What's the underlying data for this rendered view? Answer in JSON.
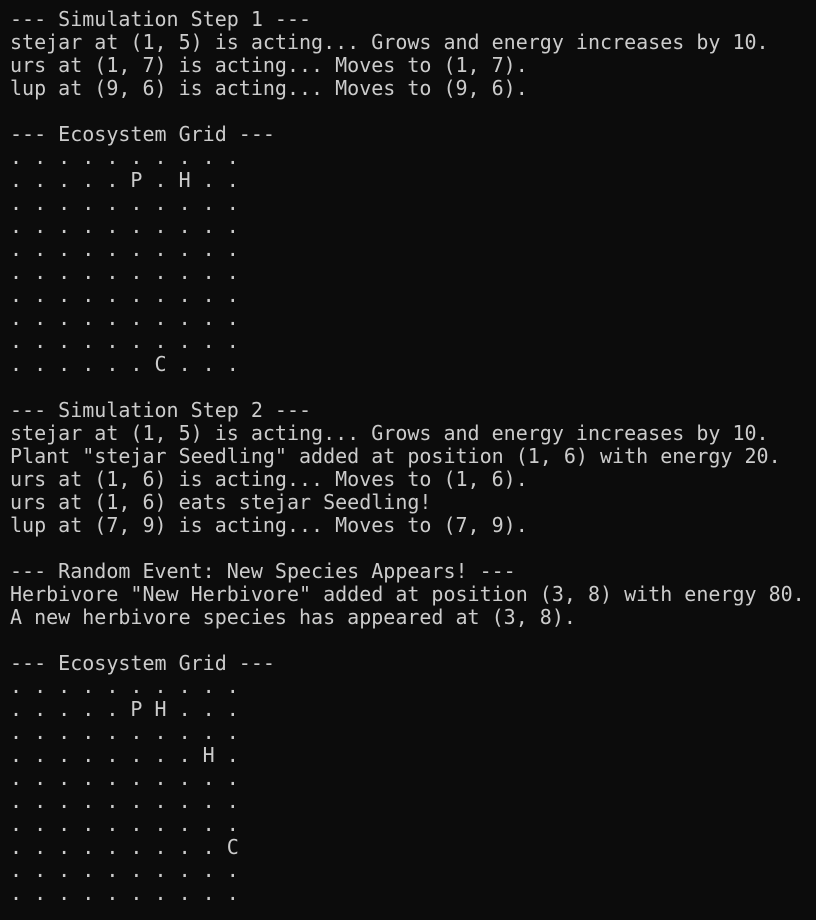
{
  "terminal": {
    "background_color": "#0c0c0c",
    "text_color": "#cccccc",
    "lines": [
      "--- Simulation Step 1 ---",
      "stejar at (1, 5) is acting... Grows and energy increases by 10.",
      "urs at (1, 7) is acting... Moves to (1, 7).",
      "lup at (9, 6) is acting... Moves to (9, 6).",
      "",
      "--- Ecosystem Grid ---",
      ". . . . . . . . . .",
      ". . . . . P . H . .",
      ". . . . . . . . . .",
      ". . . . . . . . . .",
      ". . . . . . . . . .",
      ". . . . . . . . . .",
      ". . . . . . . . . .",
      ". . . . . . . . . .",
      ". . . . . . . . . .",
      ". . . . . . C . . .",
      "",
      "--- Simulation Step 2 ---",
      "stejar at (1, 5) is acting... Grows and energy increases by 10.",
      "Plant \"stejar Seedling\" added at position (1, 6) with energy 20.",
      "urs at (1, 6) is acting... Moves to (1, 6).",
      "urs at (1, 6) eats stejar Seedling!",
      "lup at (7, 9) is acting... Moves to (7, 9).",
      "",
      "--- Random Event: New Species Appears! ---",
      "Herbivore \"New Herbivore\" added at position (3, 8) with energy 80.",
      "A new herbivore species has appeared at (3, 8).",
      "",
      "--- Ecosystem Grid ---",
      ". . . . . . . . . .",
      ". . . . . P H . . .",
      ". . . . . . . . . .",
      ". . . . . . . . H .",
      ". . . . . . . . . .",
      ". . . . . . . . . .",
      ". . . . . . . . . .",
      ". . . . . . . . . C",
      ". . . . . . . . . .",
      ". . . . . . . . . ."
    ]
  }
}
